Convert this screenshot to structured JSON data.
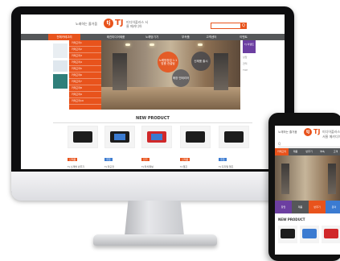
{
  "site": {
    "slogan": "노래하는 즐거움",
    "logo_mark": "tj",
    "logo_text": "TJ",
    "logo_sub": "미디어플러스 서울 메카디아",
    "search_button": "Q"
  },
  "nav": {
    "items": [
      "전체카테고리",
      "태진미디어제품",
      "노래방기기",
      "부속품",
      "고객센터",
      "이벤트"
    ]
  },
  "categories": [
    "카테고리1",
    "카테고리2",
    "카테고리3",
    "카테고리4",
    "카테고리5",
    "카테고리6",
    "카테고리7",
    "카테고리8",
    "카테고리9",
    "카테고리10"
  ],
  "hero": {
    "bubbles": [
      "노래방창업 1:1맞춤 컨설팅",
      "매장 인테리어",
      "신제품 출시"
    ]
  },
  "right_col": {
    "badge": "TJ 이벤트",
    "quick": [
      "상담",
      "견적",
      "TOP"
    ]
  },
  "section_title": "NEW PRODUCT",
  "products": [
    {
      "tag": "신제품",
      "name": "TJ 노래방 반주기",
      "style": "dark"
    },
    {
      "tag": "추천",
      "name": "TJ 리모컨",
      "style": "screen"
    },
    {
      "tag": "인기",
      "name": "TJ 터치패널",
      "style": "red"
    },
    {
      "tag": "신제품",
      "name": "TJ 앰프",
      "style": "dark"
    },
    {
      "tag": "추천",
      "name": "TJ 디지털 앰프",
      "style": "dark"
    }
  ],
  "phone": {
    "search_placeholder": "Q",
    "tabs": [
      "카테고리",
      "제품",
      "반주기",
      "부속",
      "고객"
    ],
    "cats": [
      "창업",
      "제품",
      "반주기",
      "문의"
    ],
    "section_title": "NEW PRODUCT"
  },
  "colors": {
    "accent": "#e8531c",
    "nav": "#555759",
    "purple": "#6c3fa1"
  }
}
